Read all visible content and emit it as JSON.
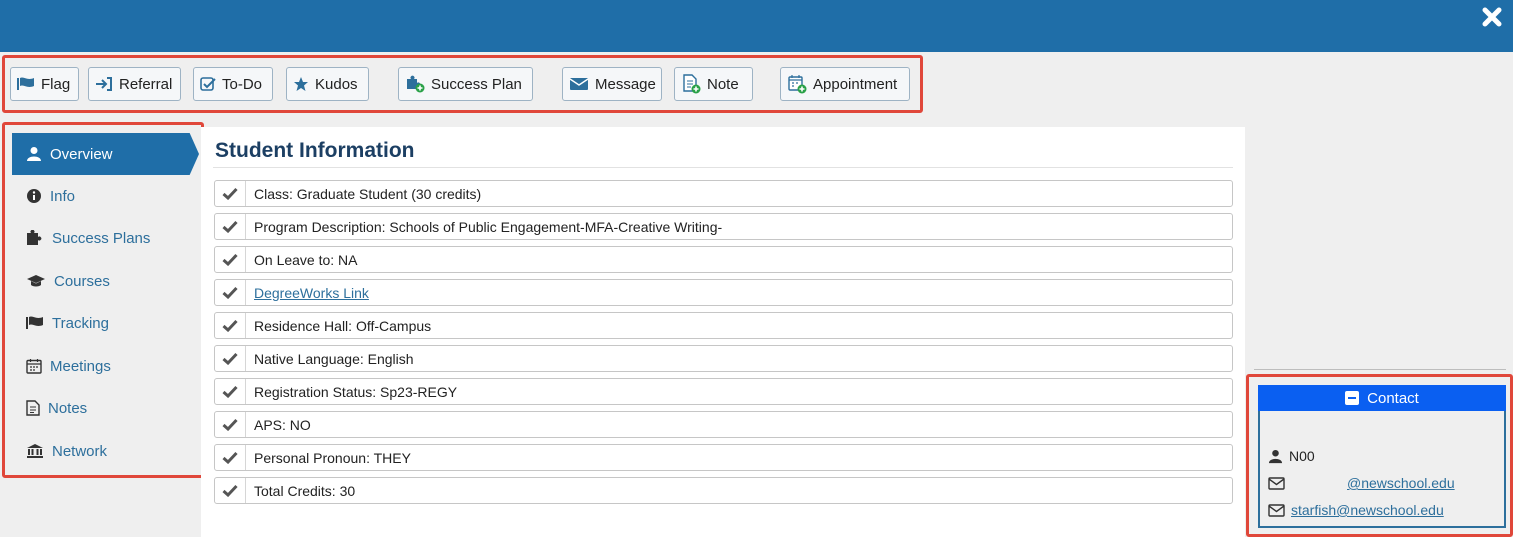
{
  "colors": {
    "header_bar": "#1f6ea8",
    "highlight_outline": "#e0473a",
    "contact_header": "#0a5ff1",
    "link": "#2d6f9c"
  },
  "window": {
    "close_icon": "close-icon"
  },
  "toolbar": {
    "buttons": [
      {
        "label": "Flag",
        "icon": "flag-icon"
      },
      {
        "label": "Referral",
        "icon": "sign-in-icon"
      },
      {
        "label": "To-Do",
        "icon": "checkbox-icon"
      },
      {
        "label": "Kudos",
        "icon": "star-icon"
      },
      {
        "label": "Success Plan",
        "icon": "puzzle-add-icon"
      },
      {
        "label": "Message",
        "icon": "envelope-icon"
      },
      {
        "label": "Note",
        "icon": "note-add-icon"
      },
      {
        "label": "Appointment",
        "icon": "calendar-add-icon"
      }
    ]
  },
  "sidebar": {
    "items": [
      {
        "label": "Overview",
        "icon": "user-icon",
        "active": true
      },
      {
        "label": "Info",
        "icon": "info-circle-icon",
        "active": false
      },
      {
        "label": "Success Plans",
        "icon": "puzzle-icon",
        "active": false
      },
      {
        "label": "Courses",
        "icon": "graduation-cap-icon",
        "active": false
      },
      {
        "label": "Tracking",
        "icon": "flag-icon",
        "active": false
      },
      {
        "label": "Meetings",
        "icon": "calendar-icon",
        "active": false
      },
      {
        "label": "Notes",
        "icon": "document-icon",
        "active": false
      },
      {
        "label": "Network",
        "icon": "institution-icon",
        "active": false
      }
    ]
  },
  "main": {
    "title": "Student Information",
    "rows": [
      {
        "text": "Class: Graduate Student (30 credits)",
        "link": false
      },
      {
        "text": "Program Description: Schools of Public Engagement-MFA-Creative Writing-",
        "link": false
      },
      {
        "text": "On Leave to: NA",
        "link": false
      },
      {
        "text": "DegreeWorks Link",
        "link": true
      },
      {
        "text": "Residence Hall: Off-Campus",
        "link": false
      },
      {
        "text": "Native Language: English",
        "link": false
      },
      {
        "text": "Registration Status: Sp23-REGY",
        "link": false
      },
      {
        "text": "APS: NO",
        "link": false
      },
      {
        "text": "Personal Pronoun: THEY",
        "link": false
      },
      {
        "text": "Total Credits: 30",
        "link": false
      }
    ]
  },
  "contact": {
    "header": "Contact",
    "id": "N00",
    "email_primary": "@newschool.edu",
    "email_secondary": "starfish@newschool.edu"
  }
}
